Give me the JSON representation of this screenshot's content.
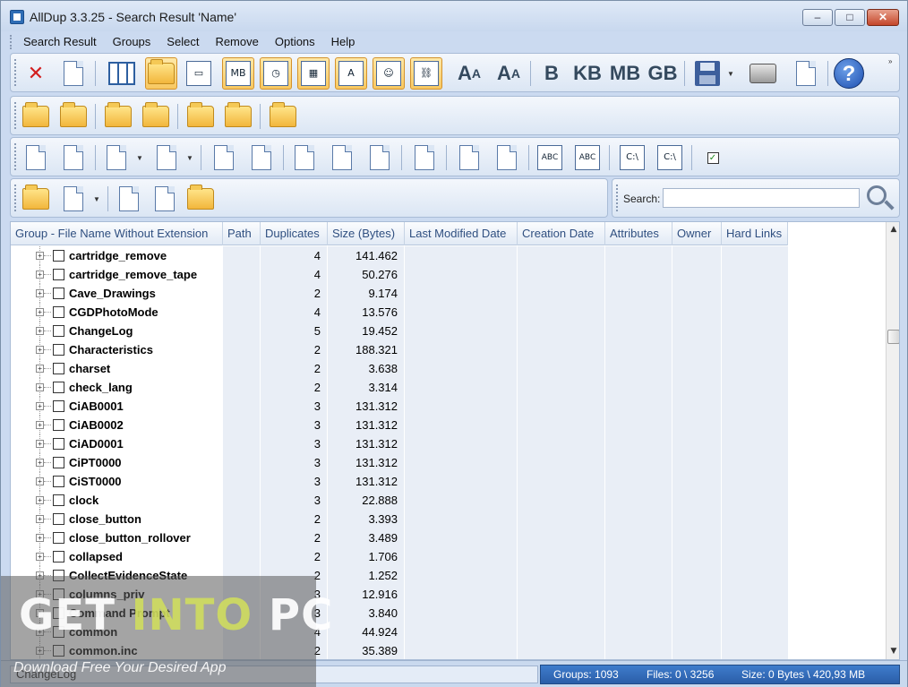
{
  "window": {
    "title": "AllDup 3.3.25 - Search Result 'Name'",
    "min_glyph": "–",
    "max_glyph": "□",
    "close_glyph": "✕"
  },
  "menu": [
    "Search Result",
    "Groups",
    "Select",
    "Remove",
    "Options",
    "Help"
  ],
  "toolbar_text": {
    "font_larger": "A",
    "font_smaller": "A",
    "b": "B",
    "kb": "KB",
    "mb": "MB",
    "gb": "GB",
    "mb_box": "MB",
    "a_box": "A",
    "help": "?",
    "abc1": "ABC",
    "abc2": "ABC",
    "c1": "C:\\",
    "c2": "C:\\"
  },
  "search": {
    "label": "Search:",
    "value": ""
  },
  "columns": [
    "Group - File Name Without Extension",
    "Path",
    "Duplicates",
    "Size (Bytes)",
    "Last Modified Date",
    "Creation Date",
    "Attributes",
    "Owner",
    "Hard Links"
  ],
  "rows": [
    {
      "name": "cartridge_remove",
      "duplicates": "4",
      "size": "141.462"
    },
    {
      "name": "cartridge_remove_tape",
      "duplicates": "4",
      "size": "50.276"
    },
    {
      "name": "Cave_Drawings",
      "duplicates": "2",
      "size": "9.174"
    },
    {
      "name": "CGDPhotoMode",
      "duplicates": "4",
      "size": "13.576"
    },
    {
      "name": "ChangeLog",
      "duplicates": "5",
      "size": "19.452"
    },
    {
      "name": "Characteristics",
      "duplicates": "2",
      "size": "188.321"
    },
    {
      "name": "charset",
      "duplicates": "2",
      "size": "3.638"
    },
    {
      "name": "check_lang",
      "duplicates": "2",
      "size": "3.314"
    },
    {
      "name": "CiAB0001",
      "duplicates": "3",
      "size": "131.312"
    },
    {
      "name": "CiAB0002",
      "duplicates": "3",
      "size": "131.312"
    },
    {
      "name": "CiAD0001",
      "duplicates": "3",
      "size": "131.312"
    },
    {
      "name": "CiPT0000",
      "duplicates": "3",
      "size": "131.312"
    },
    {
      "name": "CiST0000",
      "duplicates": "3",
      "size": "131.312"
    },
    {
      "name": "clock",
      "duplicates": "3",
      "size": "22.888"
    },
    {
      "name": "close_button",
      "duplicates": "2",
      "size": "3.393"
    },
    {
      "name": "close_button_rollover",
      "duplicates": "2",
      "size": "3.489"
    },
    {
      "name": "collapsed",
      "duplicates": "2",
      "size": "1.706"
    },
    {
      "name": "CollectEvidenceState",
      "duplicates": "2",
      "size": "1.252"
    },
    {
      "name": "columns_priv",
      "duplicates": "3",
      "size": "12.916"
    },
    {
      "name": "Command Prompt",
      "duplicates": "3",
      "size": "3.840"
    },
    {
      "name": "common",
      "duplicates": "4",
      "size": "44.924"
    },
    {
      "name": "common.inc",
      "duplicates": "2",
      "size": "35.389"
    }
  ],
  "status": {
    "left": "ChangeLog",
    "groups": "Groups: 1093",
    "files": "Files: 0 \\ 3256",
    "size": "Size: 0 Bytes \\ 420,93 MB"
  },
  "watermark": {
    "get": "GET ",
    "into": "INTO",
    "pc": " PC",
    "tagline": "Download Free Your Desired App"
  }
}
